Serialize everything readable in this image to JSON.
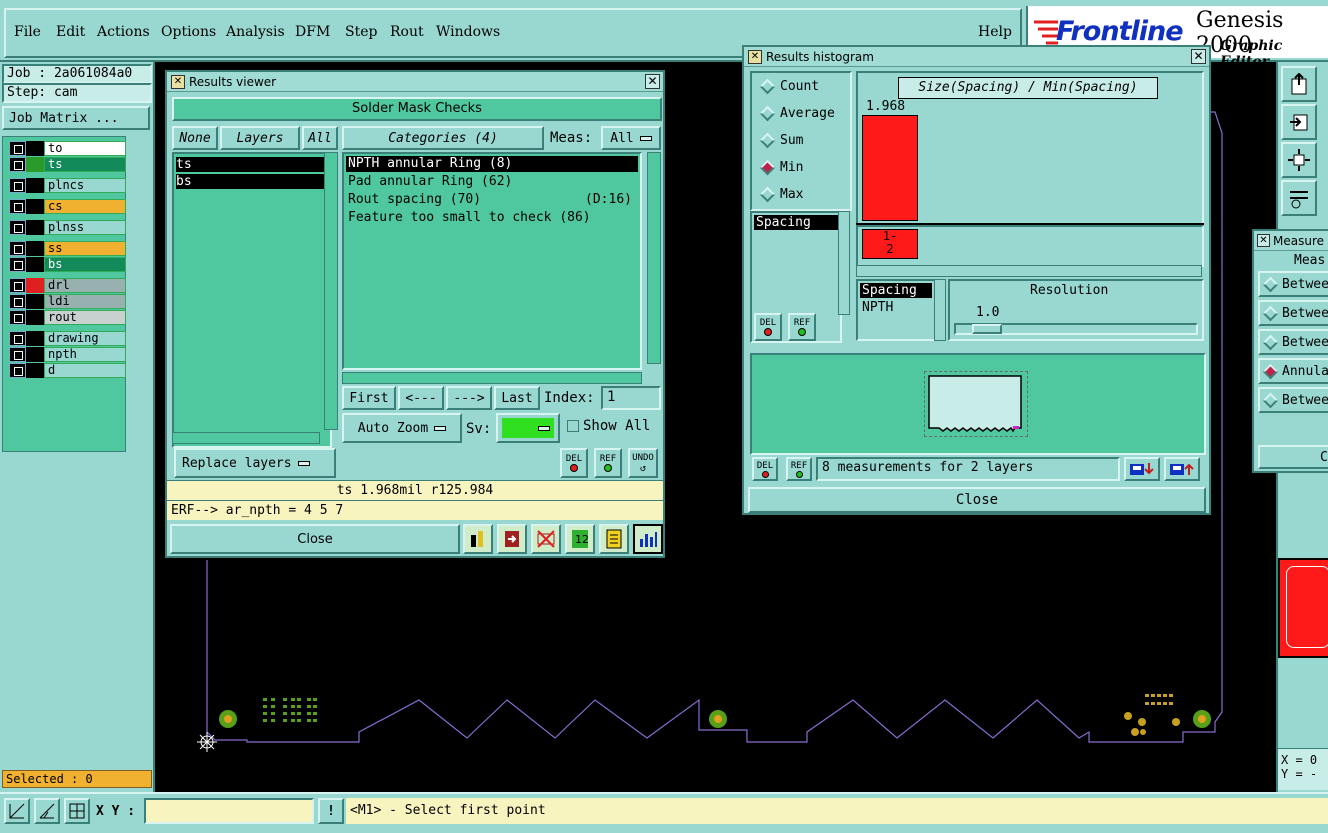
{
  "menubar": {
    "items": [
      "File",
      "Edit",
      "Actions",
      "Options",
      "Analysis",
      "DFM",
      "Step",
      "Rout",
      "Windows"
    ],
    "help": "Help",
    "brand_logo": "Frontline",
    "brand_product": "Genesis 2000",
    "brand_sub": "Graphic Editor"
  },
  "left_panel": {
    "job_label": "Job : 2a061084a0",
    "step_label": "Step: cam",
    "job_matrix_button": "Job Matrix ...",
    "layers": [
      {
        "name": "to",
        "swatch": "#000000",
        "bg": "#ffffff"
      },
      {
        "name": "ts",
        "swatch": "#2a9a2a",
        "bg": "#128a5a"
      },
      {
        "name": "plncs",
        "swatch": "#000000",
        "bg": "#98d8d0"
      },
      {
        "name": "cs",
        "swatch": "#000000",
        "bg": "#f0b030"
      },
      {
        "name": "plnss",
        "swatch": "#000000",
        "bg": "#98d8d0"
      },
      {
        "name": "ss",
        "swatch": "#000000",
        "bg": "#f0b030"
      },
      {
        "name": "bs",
        "swatch": "#000000",
        "bg": "#128a5a"
      },
      {
        "name": "drl",
        "swatch": "#e02020",
        "bg": "#98b0b0"
      },
      {
        "name": "ldi",
        "swatch": "#000000",
        "bg": "#98b0b0"
      },
      {
        "name": "rout",
        "swatch": "#000000",
        "bg": "#c8d0d0"
      },
      {
        "name": "drawing",
        "swatch": "#000000",
        "bg": "#98d8d0"
      },
      {
        "name": "npth",
        "swatch": "#000000",
        "bg": "#98d8d0"
      },
      {
        "name": "d",
        "swatch": "#000000",
        "bg": "#98d8d0"
      }
    ],
    "selected_label": "Selected : 0"
  },
  "results_viewer": {
    "title": "Results viewer",
    "header": "Solder Mask Checks",
    "none_button": "None",
    "layers_button": "Layers",
    "all_button": "All",
    "layer_list": [
      "ts",
      "bs"
    ],
    "categories_button": "Categories (4)",
    "meas_label": "Meas:",
    "meas_value": "All",
    "categories": [
      {
        "text": "NPTH annular Ring (8)",
        "extra": ""
      },
      {
        "text": "Pad annular Ring (62)",
        "extra": ""
      },
      {
        "text": "Rout spacing (70)",
        "extra": "(D:16)"
      },
      {
        "text": "Feature too small to check (86)",
        "extra": ""
      }
    ],
    "first_button": "First",
    "prev_button": "<---",
    "next_button": "--->",
    "last_button": "Last",
    "index_label": "Index:",
    "index_value": "1",
    "auto_zoom": "Auto Zoom",
    "sv_label": "Sv:",
    "show_all": "Show All",
    "replace_layers": "Replace layers",
    "del": "DEL",
    "ref": "REF",
    "undo": "UNDO",
    "info_line": "ts 1.968mil  r125.984",
    "erf_line": "ERF--> ar_npth = 4 5 7",
    "close": "Close"
  },
  "histogram": {
    "title": "Results histogram",
    "options": [
      "Count",
      "Average",
      "Sum",
      "Min",
      "Max"
    ],
    "selected_option": "Min",
    "meas_list_item": "Spacing",
    "chart_title": "Size(Spacing) / Min(Spacing)",
    "bar_value_label": "1.968",
    "bin_label_top": "1-",
    "bin_label_bottom": "2",
    "bar_fraction": 1.0,
    "bar_color": "#ff1a1a",
    "list2": [
      "Spacing",
      "NPTH"
    ],
    "resolution_label": "Resolution",
    "resolution_value": "1.0",
    "del": "DEL",
    "ref": "REF",
    "status": "8 measurements for 2 layers",
    "close": "Close"
  },
  "measure_window": {
    "title": "Measure",
    "header": "Meas",
    "items": [
      "Betwee",
      "Betwee",
      "Betwee",
      "Annula",
      "Betwee"
    ],
    "selected_index": 3,
    "bottom_button": "C"
  },
  "right_readout": {
    "x": "X = 0",
    "y": "Y = -"
  },
  "status_bar": {
    "xy_label": "X Y :",
    "xy_value": "",
    "alert": "!",
    "prompt": "<M1> - Select first point"
  }
}
